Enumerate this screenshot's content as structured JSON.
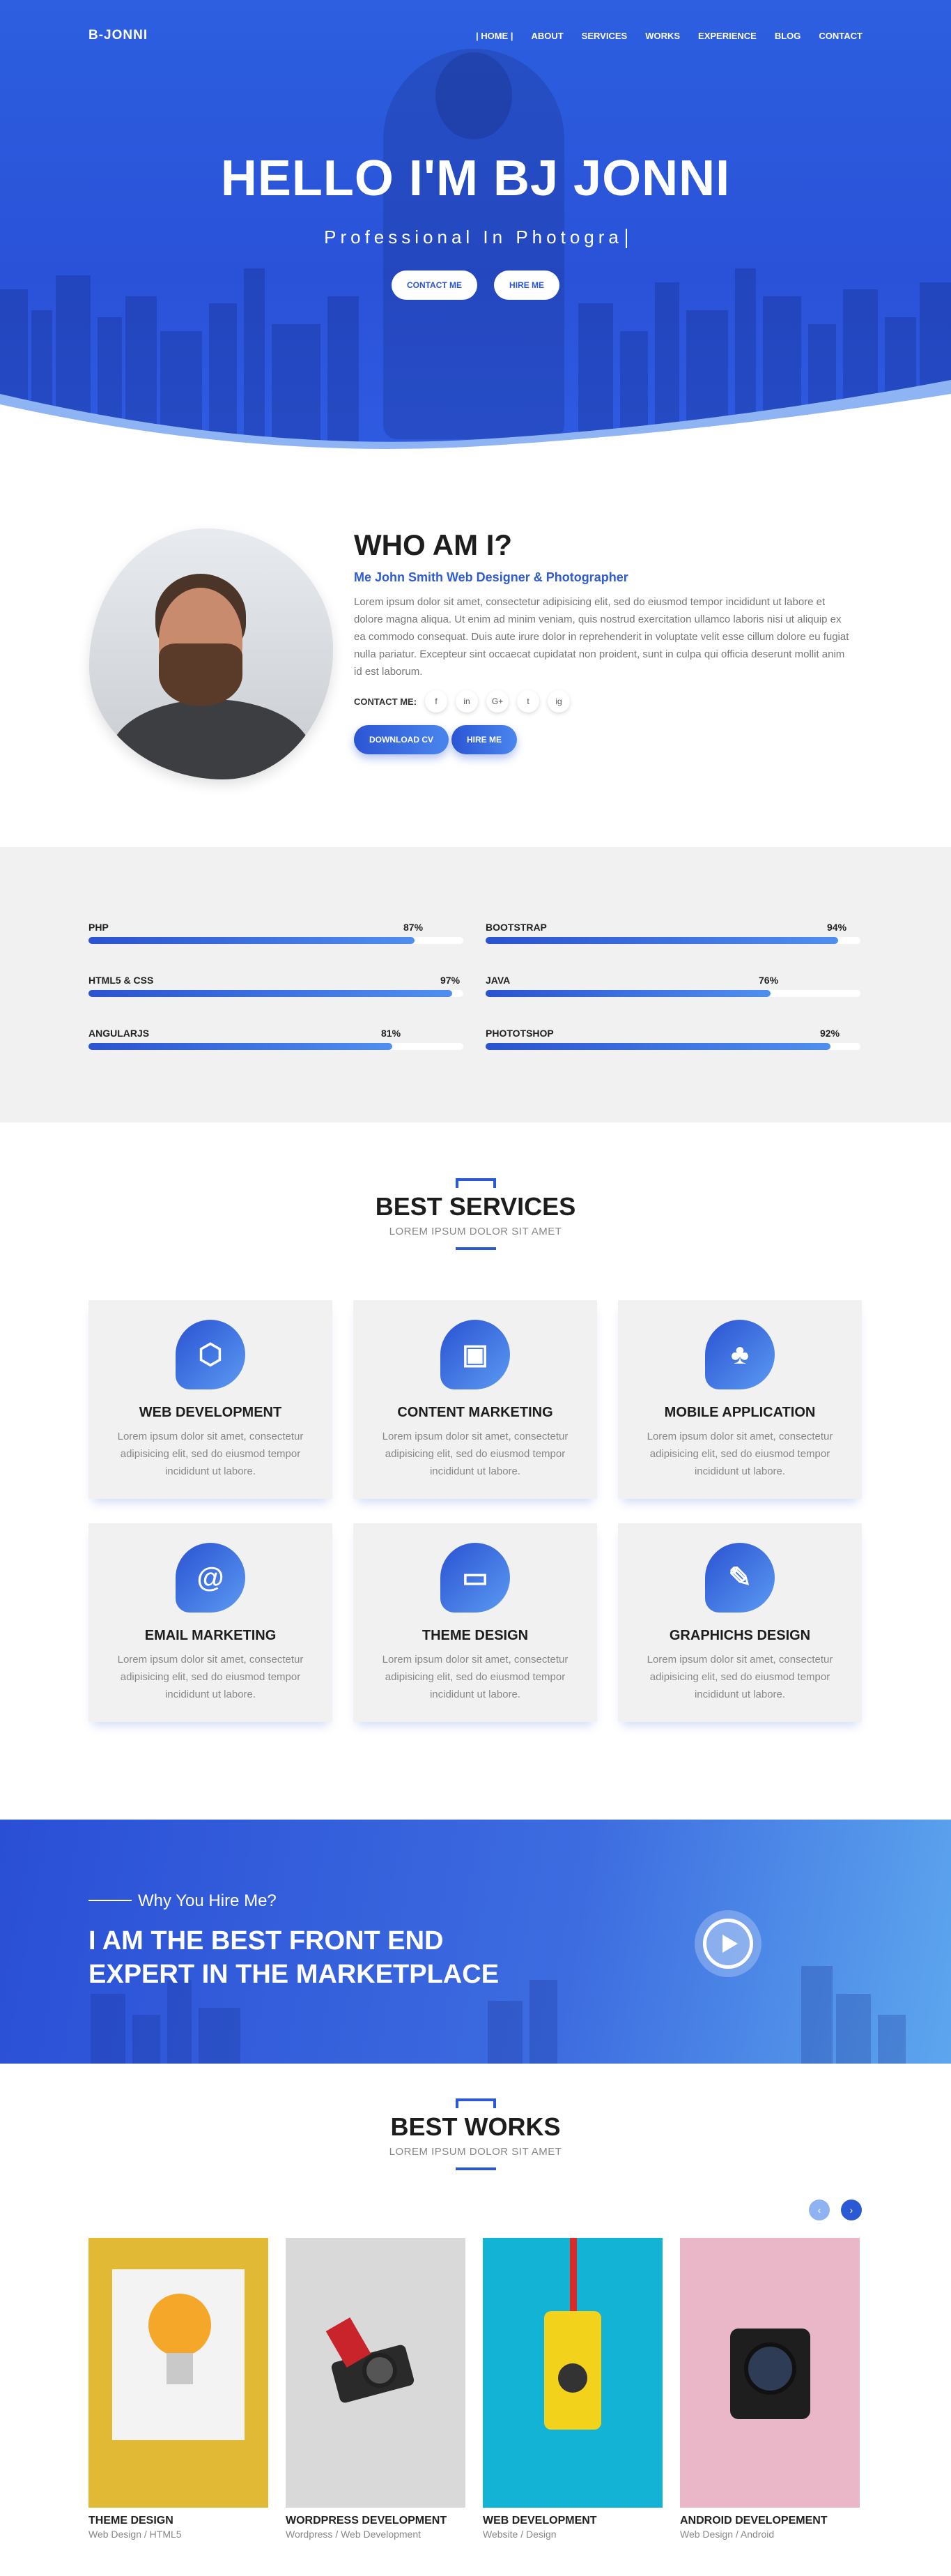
{
  "nav": {
    "logo": "B-JONNI",
    "items": [
      "| HOME |",
      "ABOUT",
      "SERVICES",
      "WORKS",
      "EXPERIENCE",
      "BLOG",
      "CONTACT"
    ]
  },
  "hero": {
    "title": "HELLO I'M BJ JONNI",
    "subtitle": "Professional In Photogra",
    "contact_btn": "CONTACT ME",
    "hire_btn": "HIRE ME"
  },
  "about": {
    "title": "WHO AM I?",
    "role": "Me John Smith Web Designer & Photographer",
    "text": "Lorem ipsum dolor sit amet, consectetur adipisicing elit, sed do eiusmod tempor incididunt ut labore et dolore magna aliqua. Ut enim ad minim veniam, quis nostrud exercitation ullamco laboris nisi ut aliquip ex ea commodo consequat. Duis aute irure dolor in reprehenderit in voluptate velit esse cillum dolore eu fugiat nulla pariatur. Excepteur sint occaecat cupidatat non proident, sunt in culpa qui officia deserunt mollit anim id est laborum.",
    "contact_label": "CONTACT ME:",
    "socials": [
      "f",
      "in",
      "G+",
      "t",
      "ig"
    ],
    "download_btn": "DOWNLOAD CV",
    "hire_btn": "HIRE ME"
  },
  "skills": [
    {
      "name": "PHP",
      "percent": "87%",
      "value": 87
    },
    {
      "name": "BOOTSTRAP",
      "percent": "94%",
      "value": 94
    },
    {
      "name": "HTML5 & CSS",
      "percent": "97%",
      "value": 97
    },
    {
      "name": "JAVA",
      "percent": "76%",
      "value": 76
    },
    {
      "name": "ANGULARJS",
      "percent": "81%",
      "value": 81
    },
    {
      "name": "PHOTOTSHOP",
      "percent": "92%",
      "value": 92
    }
  ],
  "services": {
    "title": "BEST SERVICES",
    "subtitle": "LOREM IPSUM DOLOR SIT AMET",
    "items": [
      {
        "title": "WEB DEVELOPMENT",
        "icon": "cube-icon",
        "glyph": "⬡",
        "text": "Lorem ipsum dolor sit amet, consectetur adipisicing elit, sed do eiusmod tempor incididunt ut labore."
      },
      {
        "title": "CONTENT MARKETING",
        "icon": "briefcase-icon",
        "glyph": "▣",
        "text": "Lorem ipsum dolor sit amet, consectetur adipisicing elit, sed do eiusmod tempor incididunt ut labore."
      },
      {
        "title": "MOBILE APPLICATION",
        "icon": "android-icon",
        "glyph": "♣",
        "text": "Lorem ipsum dolor sit amet, consectetur adipisicing elit, sed do eiusmod tempor incididunt ut labore."
      },
      {
        "title": "EMAIL MARKETING",
        "icon": "at-icon",
        "glyph": "@",
        "text": "Lorem ipsum dolor sit amet, consectetur adipisicing elit, sed do eiusmod tempor incididunt ut labore."
      },
      {
        "title": "THEME DESIGN",
        "icon": "monitor-icon",
        "glyph": "▭",
        "text": "Lorem ipsum dolor sit amet, consectetur adipisicing elit, sed do eiusmod tempor incididunt ut labore."
      },
      {
        "title": "GRAPHICHS DESIGN",
        "icon": "brush-icon",
        "glyph": "✎",
        "text": "Lorem ipsum dolor sit amet, consectetur adipisicing elit, sed do eiusmod tempor incididunt ut labore."
      }
    ]
  },
  "hire": {
    "why": "Why You Hire Me?",
    "line1": "I AM THE BEST FRONT END",
    "line2": "EXPERT IN THE MARKETPLACE"
  },
  "works": {
    "title": "BEST WORKS",
    "subtitle": "LOREM IPSUM DOLOR SIT AMET",
    "items": [
      {
        "title": "THEME DESIGN",
        "category": "Web Design / HTML5",
        "bg": "#e2b934"
      },
      {
        "title": "WORDPRESS DEVELOPMENT",
        "category": "Wordpress / Web Development",
        "bg": "#d9d9d9"
      },
      {
        "title": "WEB DEVELOPMENT",
        "category": "Website / Design",
        "bg": "#13b3d6"
      },
      {
        "title": "ANDROID DEVELOPEMENT",
        "category": "Web Design / Android",
        "bg": "#eab7c9"
      }
    ]
  },
  "colors": {
    "accent": "#2b59d5",
    "accent_light": "#5da6ee"
  }
}
